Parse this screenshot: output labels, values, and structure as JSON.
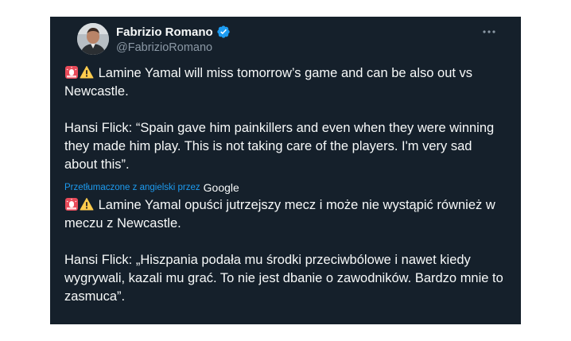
{
  "tweet": {
    "display_name": "Fabrizio Romano",
    "handle": "@FabrizioRomano",
    "verified": true,
    "original": {
      "line1": "Lamine Yamal will miss tomorrow’s game and can be also out vs Newcastle.",
      "quote": "Hansi Flick: “Spain gave him painkillers and even when they were winning they made him play. This is not taking care of the players. I'm very sad about this”."
    },
    "translation_notice": "Przetłumaczone z angielski przez",
    "translation_provider": "Google",
    "translated": {
      "line1": "Lamine Yamal opuści jutrzejszy mecz i może nie wystąpić również w meczu z Newcastle.",
      "quote": "Hansi Flick: „Hiszpania podała mu środki przeciwbólowe i nawet kiedy wygrywali, kazali mu grać. To nie jest dbanie o zawodników. Bardzo mnie to zasmuca”."
    }
  },
  "icons": {
    "siren": "rotating-light-icon",
    "warning": "warning-icon",
    "more": "more-icon",
    "verified": "verified-badge-icon"
  },
  "colors": {
    "card_background": "#15202b",
    "text": "#f7f9f9",
    "secondary_text": "#8b98a5",
    "accent": "#1d9bf0"
  }
}
